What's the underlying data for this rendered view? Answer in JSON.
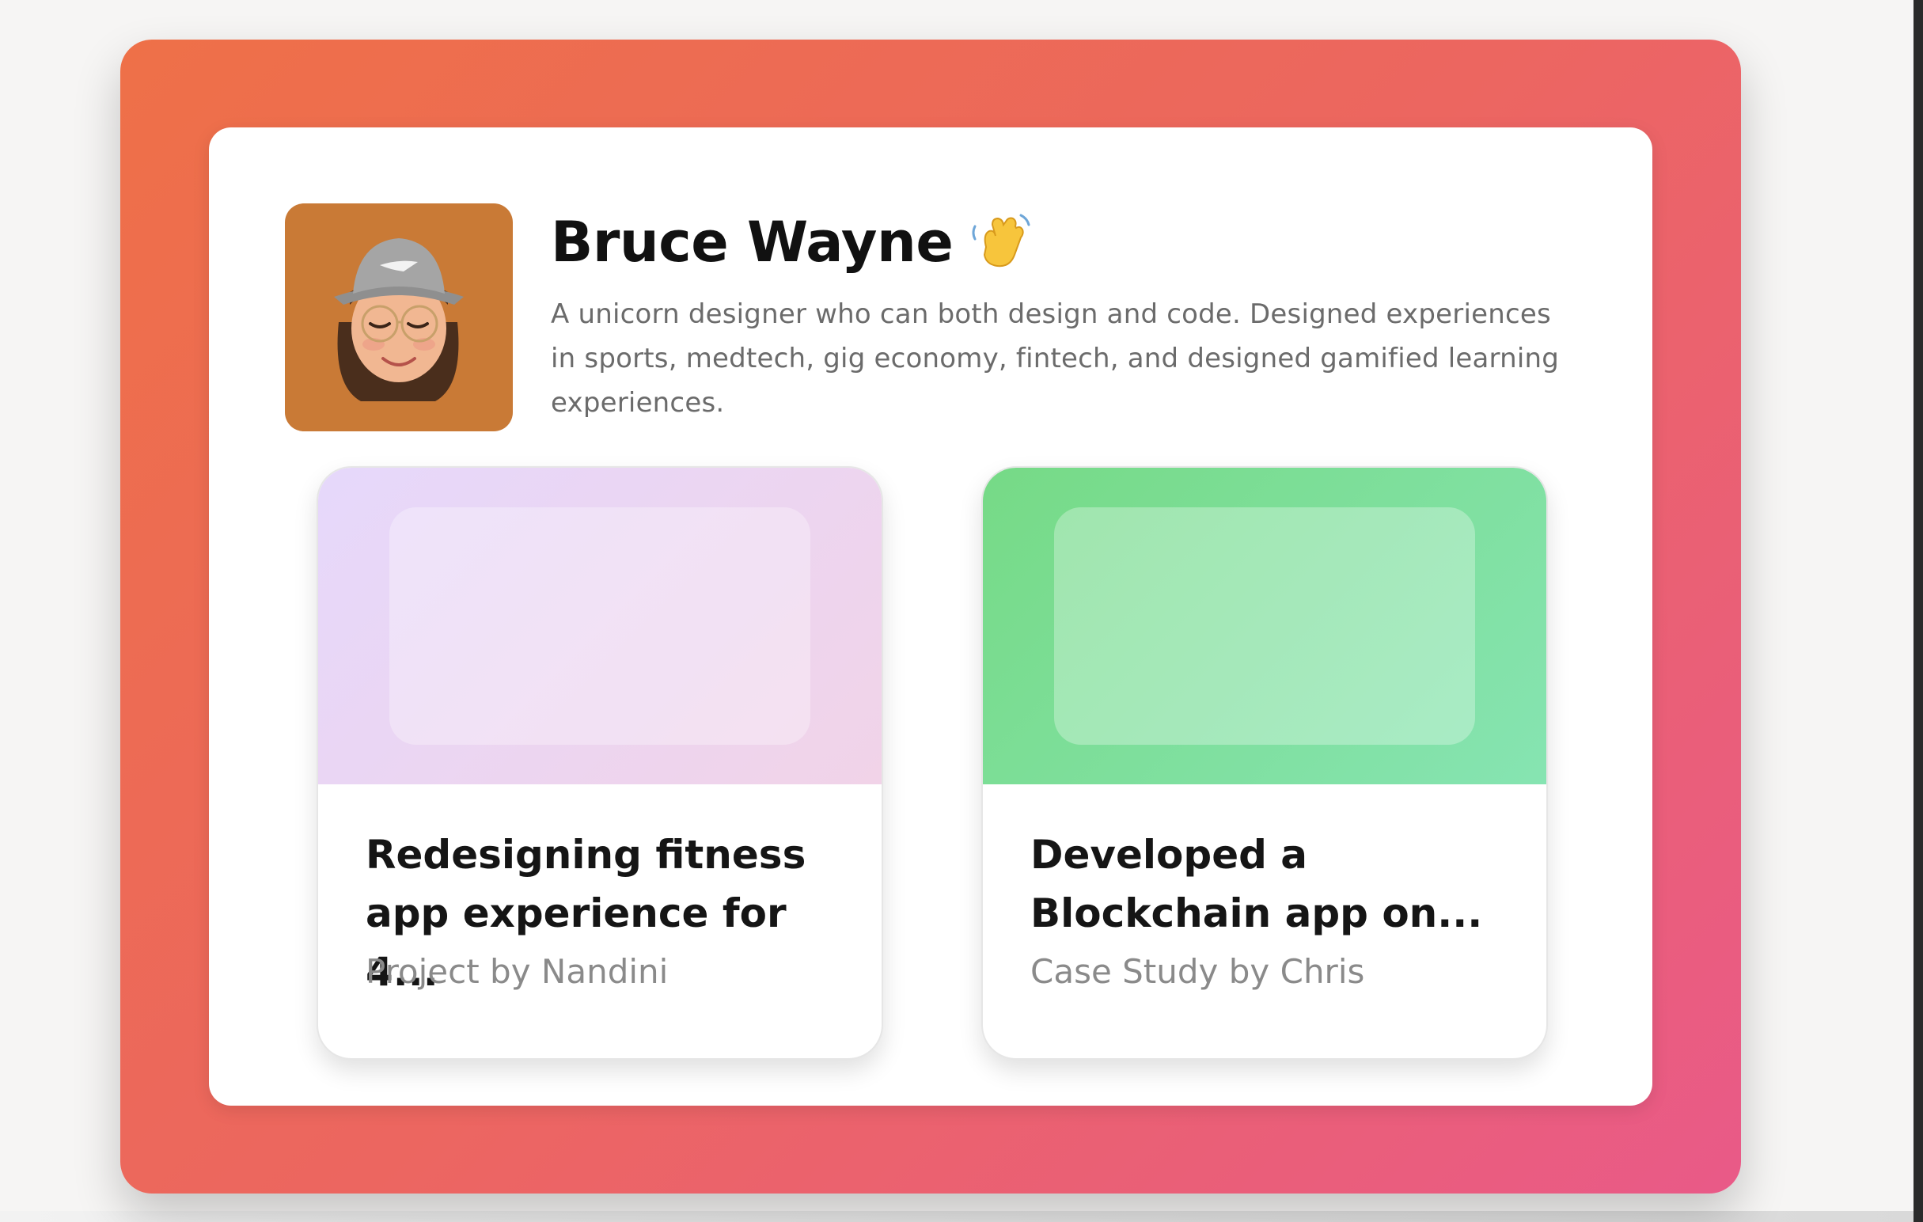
{
  "profile": {
    "name": "Bruce Wayne",
    "wave_emoji": "waving-hand-icon",
    "avatar_icon": "memoji-avatar-icon",
    "bio": "A unicorn designer who can both design and code. Designed experiences in sports, medtech, gig economy, fintech, and designed gamified learning experiences."
  },
  "projects": [
    {
      "title": "Redesigning fitness\napp experience for 4...",
      "subtitle": "Project by Nandini",
      "cover_color": "#e8d6f6"
    },
    {
      "title": "Developed a\nBlockchain app on...",
      "subtitle": "Case Study by Chris",
      "cover_color": "#7ddf99"
    }
  ],
  "colors": {
    "frame_gradient_start": "#ee7048",
    "frame_gradient_end": "#e95a88",
    "avatar_bg": "#c97a36"
  }
}
